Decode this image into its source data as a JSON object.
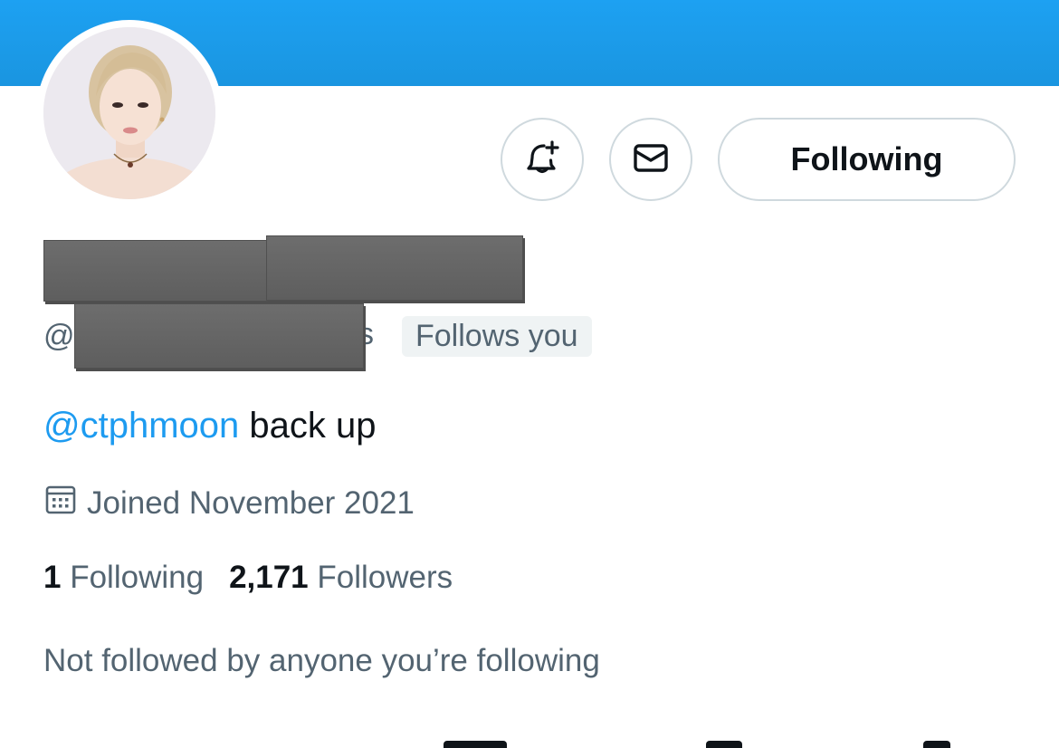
{
  "header": {
    "banner_color": "#1d9bf0"
  },
  "profile": {
    "avatar_alt": "profile photo",
    "handle_prefix": "@",
    "handle_suffix": "s",
    "follows_you": "Follows you",
    "bio_mention": "@ctphmoon",
    "bio_text": " back up",
    "joined": "Joined November 2021",
    "following_count": "1",
    "following_label": "Following",
    "followers_count": "2,171",
    "followers_label": "Followers",
    "mutuals_text": "Not followed by anyone you’re following"
  },
  "actions": {
    "notify_icon": "bell-plus-icon",
    "message_icon": "envelope-icon",
    "following_button": "Following"
  },
  "colors": {
    "accent": "#1d9bf0",
    "text_primary": "#0f1419",
    "text_secondary": "#536471",
    "border": "#cfd9de",
    "badge_bg": "#eff3f4"
  }
}
